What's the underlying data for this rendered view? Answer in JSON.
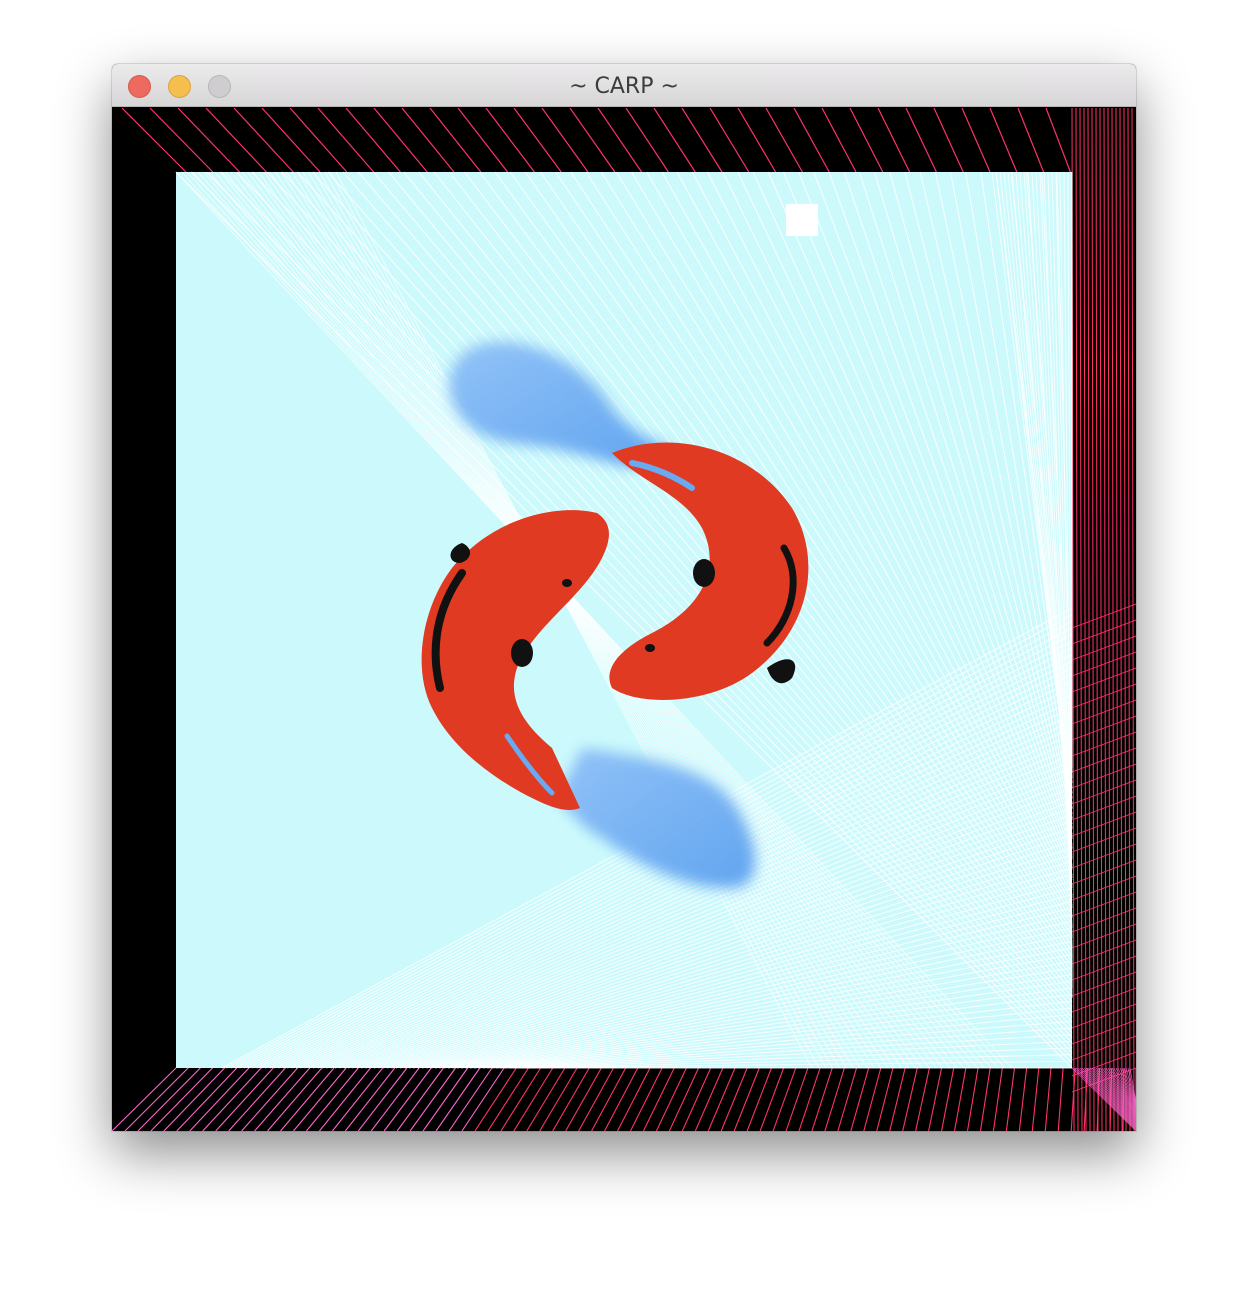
{
  "window": {
    "title": "~ CARP ~"
  },
  "colors": {
    "background": "#000000",
    "pond": "#ccfafc",
    "string_lines": "#ff3366",
    "string_highlight": "#ff66cc",
    "white_lines": "#ffffff",
    "koi_body": "#e03a22",
    "koi_fin": "#6aaaf2",
    "koi_spots": "#111111"
  },
  "icons": {
    "close": "close-icon",
    "minimize": "minimize-icon",
    "zoom": "zoom-icon"
  }
}
